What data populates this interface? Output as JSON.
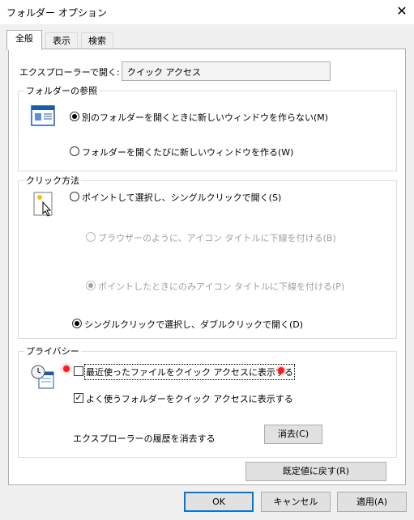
{
  "window": {
    "title": "フォルダー オプション",
    "close_glyph": "✕"
  },
  "tabs": [
    "全般",
    "表示",
    "検索"
  ],
  "open_explorer": {
    "label": "エクスプローラーで開く:",
    "value": "クイック アクセス",
    "arrow": "⌄"
  },
  "browse": {
    "title": "フォルダーの参照",
    "same_window": "別のフォルダーを開くときに新しいウィンドウを作らない(M)",
    "new_window": "フォルダーを開くたびに新しいウィンドウを作る(W)",
    "selected": "same_window"
  },
  "click": {
    "title": "クリック方法",
    "single_click": "ポイントして選択し、シングルクリックで開く(S)",
    "underline_browser": "ブラウザーのように、アイコン タイトルに下線を付ける(B)",
    "underline_point": "ポイントしたときにのみアイコン タイトルに下線を付ける(P)",
    "double_click": "シングルクリックで選択し、ダブルクリックで開く(D)",
    "selected": "double_click"
  },
  "privacy": {
    "title": "プライバシー",
    "recent_files": "最近使ったファイルをクイック アクセスに表示する",
    "recent_files_checked": false,
    "frequent_folders": "よく使うフォルダーをクイック アクセスに表示する",
    "frequent_folders_checked": true,
    "clear_history": "エクスプローラーの履歴を消去する",
    "clear_button": "消去(C)"
  },
  "restore_defaults": "既定値に戻す(R)",
  "buttons": {
    "ok": "OK",
    "cancel": "キャンセル",
    "apply": "適用(A)"
  },
  "colors": {
    "accent": "#0078d7",
    "marker": "#ff1a1a"
  }
}
